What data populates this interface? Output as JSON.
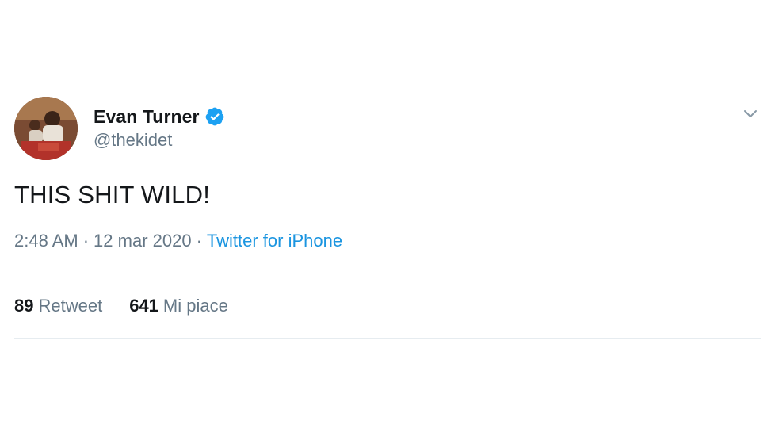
{
  "tweet": {
    "author": {
      "display_name": "Evan Turner",
      "handle": "@thekidet",
      "verified": true
    },
    "text": "THIS SHIT WILD!",
    "meta": {
      "time": "2:48 AM",
      "date": "12 mar 2020",
      "separator": "·",
      "source": "Twitter for iPhone"
    },
    "stats": {
      "retweets_count": "89",
      "retweets_label": "Retweet",
      "likes_count": "641",
      "likes_label": "Mi piace"
    }
  },
  "colors": {
    "text_primary": "#14171a",
    "text_secondary": "#657786",
    "link": "#1b95e0",
    "verified_badge": "#1da1f2",
    "divider": "#e6ecf0"
  },
  "icons": {
    "verified": "verified-badge-icon",
    "menu": "chevron-down-icon"
  }
}
